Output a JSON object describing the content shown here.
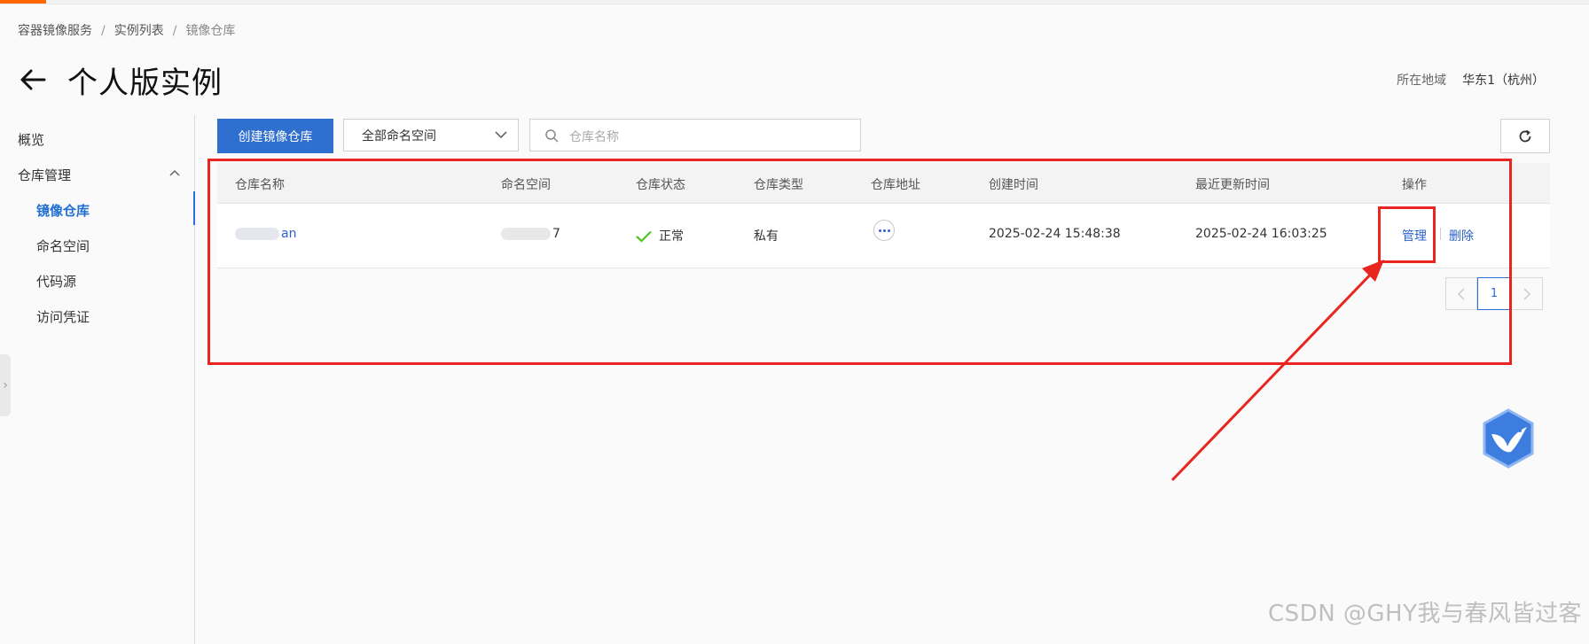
{
  "breadcrumb": {
    "items": [
      "容器镜像服务",
      "实例列表",
      "镜像仓库"
    ],
    "separator": "/"
  },
  "page": {
    "title": "个人版实例",
    "back_icon": "arrow-left-icon"
  },
  "region": {
    "label": "所在地域",
    "value": "华东1（杭州）"
  },
  "sidebar": {
    "overview": "概览",
    "repo_mgmt": "仓库管理",
    "items": [
      {
        "label": "镜像仓库",
        "active": true
      },
      {
        "label": "命名空间",
        "active": false
      },
      {
        "label": "代码源",
        "active": false
      },
      {
        "label": "访问凭证",
        "active": false
      }
    ]
  },
  "toolbar": {
    "create_label": "创建镜像仓库",
    "namespace_select": "全部命名空间",
    "search_placeholder": "仓库名称",
    "refresh_icon": "refresh-icon"
  },
  "table": {
    "headers": [
      "仓库名称",
      "命名空间",
      "仓库状态",
      "仓库类型",
      "仓库地址",
      "创建时间",
      "最近更新时间",
      "操作"
    ],
    "rows": [
      {
        "name_suffix": "an",
        "namespace_suffix": "7",
        "status": "正常",
        "type": "私有",
        "created": "2025-02-24 15:48:38",
        "updated": "2025-02-24 16:03:25",
        "op_manage": "管理",
        "op_delete": "删除"
      }
    ]
  },
  "pagination": {
    "current": "1"
  },
  "colors": {
    "primary": "#2f6fd0",
    "link": "#2a62c9",
    "success": "#52c41a",
    "annotation": "#e8261f",
    "brand_accent": "#ff6a00"
  },
  "watermark": "CSDN @GHY我与春风皆过客"
}
